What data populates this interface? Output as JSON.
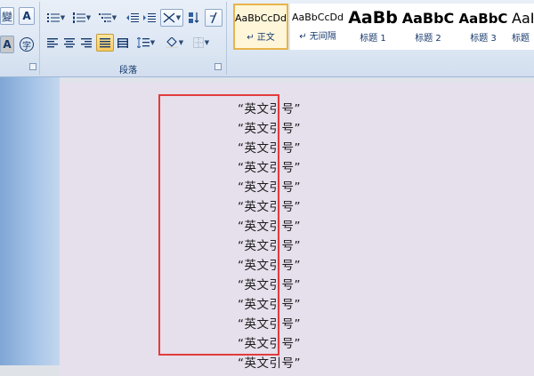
{
  "ribbon": {
    "paragraph_group_label": "段落",
    "left_buttons": {
      "phonetic_glyph": "變",
      "char_border_glyph": "A",
      "char_shade_glyph": "A",
      "enclose_glyph": "字"
    },
    "styles": [
      {
        "sample": "AaBbCcDd",
        "name": "↵ 正文",
        "selected": true
      },
      {
        "sample": "AaBbCcDd",
        "name": "↵ 无间隔",
        "selected": false
      },
      {
        "sample": "AaBb",
        "name": "标题 1",
        "selected": false
      },
      {
        "sample": "AaBbC",
        "name": "标题 2",
        "selected": false
      },
      {
        "sample": "AaBbC",
        "name": "标题 3",
        "selected": false
      },
      {
        "sample": "AaBl",
        "name": "标题",
        "selected": false
      }
    ]
  },
  "document": {
    "lines": [
      "“英文引号”",
      "“英文引号”",
      "“英文引号”",
      "“英文引号”",
      "“英文引号”",
      "“英文引号”",
      "“英文引号”",
      "“英文引号”",
      "“英文引号”",
      "“英文引号”",
      "“英文引号”",
      "“英文引号”",
      "“英文引号”",
      "“英文引号”"
    ]
  },
  "colors": {
    "highlight_border": "#e23c3c",
    "selected_style": "#e8b44a",
    "active_button": "#f7c95c"
  }
}
